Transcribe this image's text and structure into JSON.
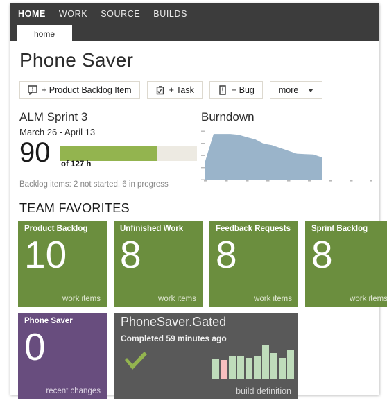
{
  "nav": {
    "items": [
      {
        "label": "HOME",
        "active": true
      },
      {
        "label": "WORK",
        "active": false
      },
      {
        "label": "SOURCE",
        "active": false
      },
      {
        "label": "BUILDS",
        "active": false
      }
    ]
  },
  "tabs": [
    {
      "label": "home",
      "active": true
    }
  ],
  "page": {
    "title": "Phone Saver"
  },
  "toolbar": {
    "buttons": [
      {
        "label": "+ Product Backlog Item",
        "icon": "speech-bubble-icon"
      },
      {
        "label": "+ Task",
        "icon": "clipboard-check-icon"
      },
      {
        "label": "+ Bug",
        "icon": "document-alert-icon"
      }
    ],
    "more_label": "more"
  },
  "sprint": {
    "name": "ALM Sprint 3",
    "dates": "March 26 - April 13",
    "hours_done": "90",
    "hours_total_label": "of 127 h",
    "progress_percent": 71,
    "backlog_note": "Backlog items: 2 not started, 6 in progress"
  },
  "burndown": {
    "title": "Burndown"
  },
  "chart_data": {
    "type": "area",
    "title": "Burndown",
    "xlabel": "",
    "ylabel": "",
    "x": [
      0,
      1,
      2,
      3,
      4,
      5,
      6,
      7,
      8,
      9,
      10,
      11,
      12,
      13,
      14
    ],
    "values": [
      52,
      127,
      127,
      127,
      125,
      118,
      112,
      100,
      96,
      88,
      80,
      72,
      71,
      70,
      62
    ],
    "ylim": [
      0,
      135
    ],
    "xlim": [
      0,
      20
    ],
    "grid": false,
    "legend": null,
    "series_color": "#9ab4ca",
    "axis_ticks_y": 5,
    "axis_ticks_x": 8,
    "note": "Remaining hours burndown; data ends at day 14, axis extends to day 20"
  },
  "favorites": {
    "heading": "TEAM FAVORITES",
    "tiles": [
      {
        "title": "Product Backlog",
        "count": "10",
        "footer": "work items",
        "color": "#6b8e3e"
      },
      {
        "title": "Unfinished Work",
        "count": "8",
        "footer": "work items",
        "color": "#6b8e3e"
      },
      {
        "title": "Feedback Requests",
        "count": "8",
        "footer": "work items",
        "color": "#6b8e3e"
      },
      {
        "title": "Sprint Backlog",
        "count": "8",
        "footer": "work items",
        "color": "#6b8e3e"
      }
    ],
    "recent_tile": {
      "title": "Phone Saver",
      "count": "0",
      "footer": "recent changes",
      "color": "#684d7e"
    },
    "build_tile": {
      "name": "PhoneSaver.Gated",
      "status": "Completed 59 minutes ago",
      "footer": "build definition",
      "result": "succeeded",
      "color": "#595959",
      "history": [
        {
          "height": 60,
          "result": "pass"
        },
        {
          "height": 56,
          "result": "fail"
        },
        {
          "height": 66,
          "result": "pass"
        },
        {
          "height": 66,
          "result": "pass"
        },
        {
          "height": 62,
          "result": "pass"
        },
        {
          "height": 66,
          "result": "pass"
        },
        {
          "height": 100,
          "result": "pass"
        },
        {
          "height": 76,
          "result": "pass"
        },
        {
          "height": 62,
          "result": "pass"
        },
        {
          "height": 84,
          "result": "pass"
        }
      ]
    }
  },
  "colors": {
    "nav_bg": "#3c3c3c",
    "accent_green": "#6b8e3e",
    "progress_green": "#93b44f",
    "purple": "#684d7e",
    "build_gray": "#595959",
    "burndown_blue": "#9ab4ca",
    "build_pass": "#bfdcbb",
    "build_fail": "#f7bfbf"
  }
}
